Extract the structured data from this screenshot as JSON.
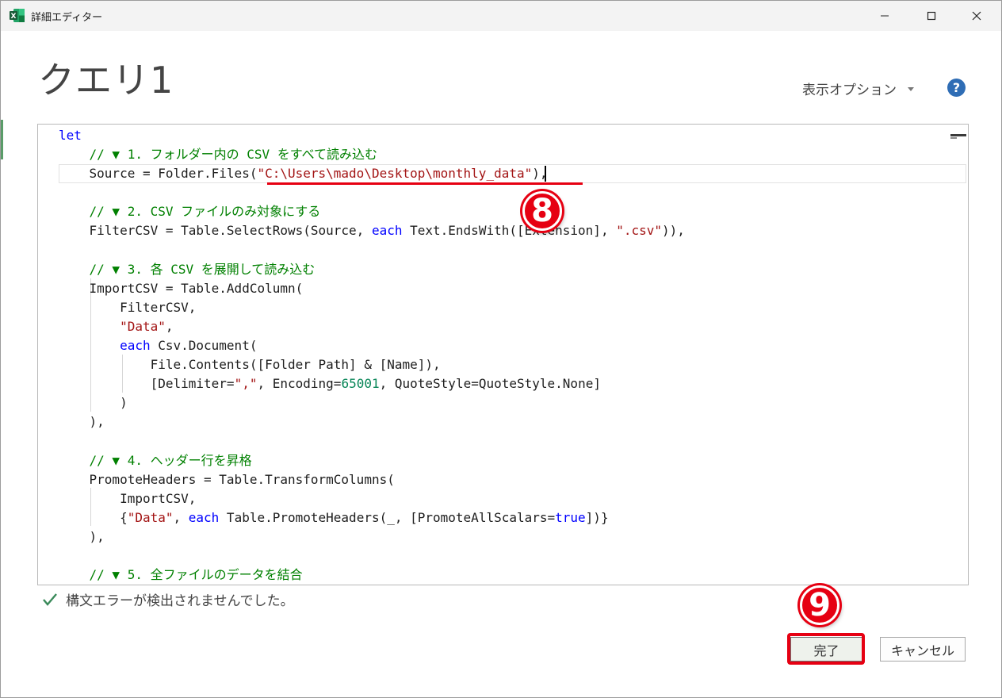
{
  "window": {
    "title": "詳細エディター",
    "app_icon": "excel-icon"
  },
  "header": {
    "title": "クエリ1",
    "options_label": "表示オプション",
    "help_label": "?"
  },
  "editor": {
    "lines": [
      [
        {
          "t": "let",
          "c": "kw"
        }
      ],
      [
        {
          "t": "    // ▼ 1. フォルダー内の CSV をすべて読み込む",
          "c": "cm"
        }
      ],
      [
        {
          "t": "    Source = Folder.Files(",
          "c": ""
        },
        {
          "t": "\"C:\\Users\\mado\\Desktop\\monthly_data\"",
          "c": "st"
        },
        {
          "t": "),",
          "c": ""
        }
      ],
      [
        {
          "t": "",
          "c": ""
        }
      ],
      [
        {
          "t": "    // ▼ 2. CSV ファイルのみ対象にする",
          "c": "cm"
        }
      ],
      [
        {
          "t": "    FilterCSV = Table.SelectRows(Source, ",
          "c": ""
        },
        {
          "t": "each",
          "c": "kw"
        },
        {
          "t": " Text.EndsWith([Extension], ",
          "c": ""
        },
        {
          "t": "\".csv\"",
          "c": "st"
        },
        {
          "t": ")),",
          "c": ""
        }
      ],
      [
        {
          "t": "",
          "c": ""
        }
      ],
      [
        {
          "t": "    // ▼ 3. 各 CSV を展開して読み込む",
          "c": "cm"
        }
      ],
      [
        {
          "t": "    ImportCSV = Table.AddColumn(",
          "c": ""
        }
      ],
      [
        {
          "t": "        FilterCSV,",
          "c": ""
        }
      ],
      [
        {
          "t": "        ",
          "c": ""
        },
        {
          "t": "\"Data\"",
          "c": "st"
        },
        {
          "t": ",",
          "c": ""
        }
      ],
      [
        {
          "t": "        ",
          "c": ""
        },
        {
          "t": "each",
          "c": "kw"
        },
        {
          "t": " Csv.Document(",
          "c": ""
        }
      ],
      [
        {
          "t": "            File.Contents([Folder Path] & [Name]),",
          "c": ""
        }
      ],
      [
        {
          "t": "            [Delimiter=",
          "c": ""
        },
        {
          "t": "\",\"",
          "c": "st"
        },
        {
          "t": ", Encoding=",
          "c": ""
        },
        {
          "t": "65001",
          "c": "nm"
        },
        {
          "t": ", QuoteStyle=QuoteStyle.None]",
          "c": ""
        }
      ],
      [
        {
          "t": "        )",
          "c": ""
        }
      ],
      [
        {
          "t": "    ),",
          "c": ""
        }
      ],
      [
        {
          "t": "",
          "c": ""
        }
      ],
      [
        {
          "t": "    // ▼ 4. ヘッダー行を昇格",
          "c": "cm"
        }
      ],
      [
        {
          "t": "    PromoteHeaders = Table.TransformColumns(",
          "c": ""
        }
      ],
      [
        {
          "t": "        ImportCSV,",
          "c": ""
        }
      ],
      [
        {
          "t": "        {",
          "c": ""
        },
        {
          "t": "\"Data\"",
          "c": "st"
        },
        {
          "t": ", ",
          "c": ""
        },
        {
          "t": "each",
          "c": "kw"
        },
        {
          "t": " Table.PromoteHeaders(_, [PromoteAllScalars=",
          "c": ""
        },
        {
          "t": "true",
          "c": "kw"
        },
        {
          "t": "])}",
          "c": ""
        }
      ],
      [
        {
          "t": "    ),",
          "c": ""
        }
      ],
      [
        {
          "t": "",
          "c": ""
        }
      ],
      [
        {
          "t": "    // ▼ 5. 全ファイルのデータを結合",
          "c": "cm"
        }
      ]
    ]
  },
  "callouts": {
    "step8": "8",
    "step9": "9"
  },
  "status": {
    "icon": "check-icon",
    "text": "構文エラーが検出されませんでした。"
  },
  "buttons": {
    "done": "完了",
    "cancel": "キャンセル"
  },
  "colors": {
    "highlight_red": "#e60012",
    "keyword": "#0000ff",
    "comment": "#008000",
    "string": "#a31515",
    "number": "#098658"
  }
}
